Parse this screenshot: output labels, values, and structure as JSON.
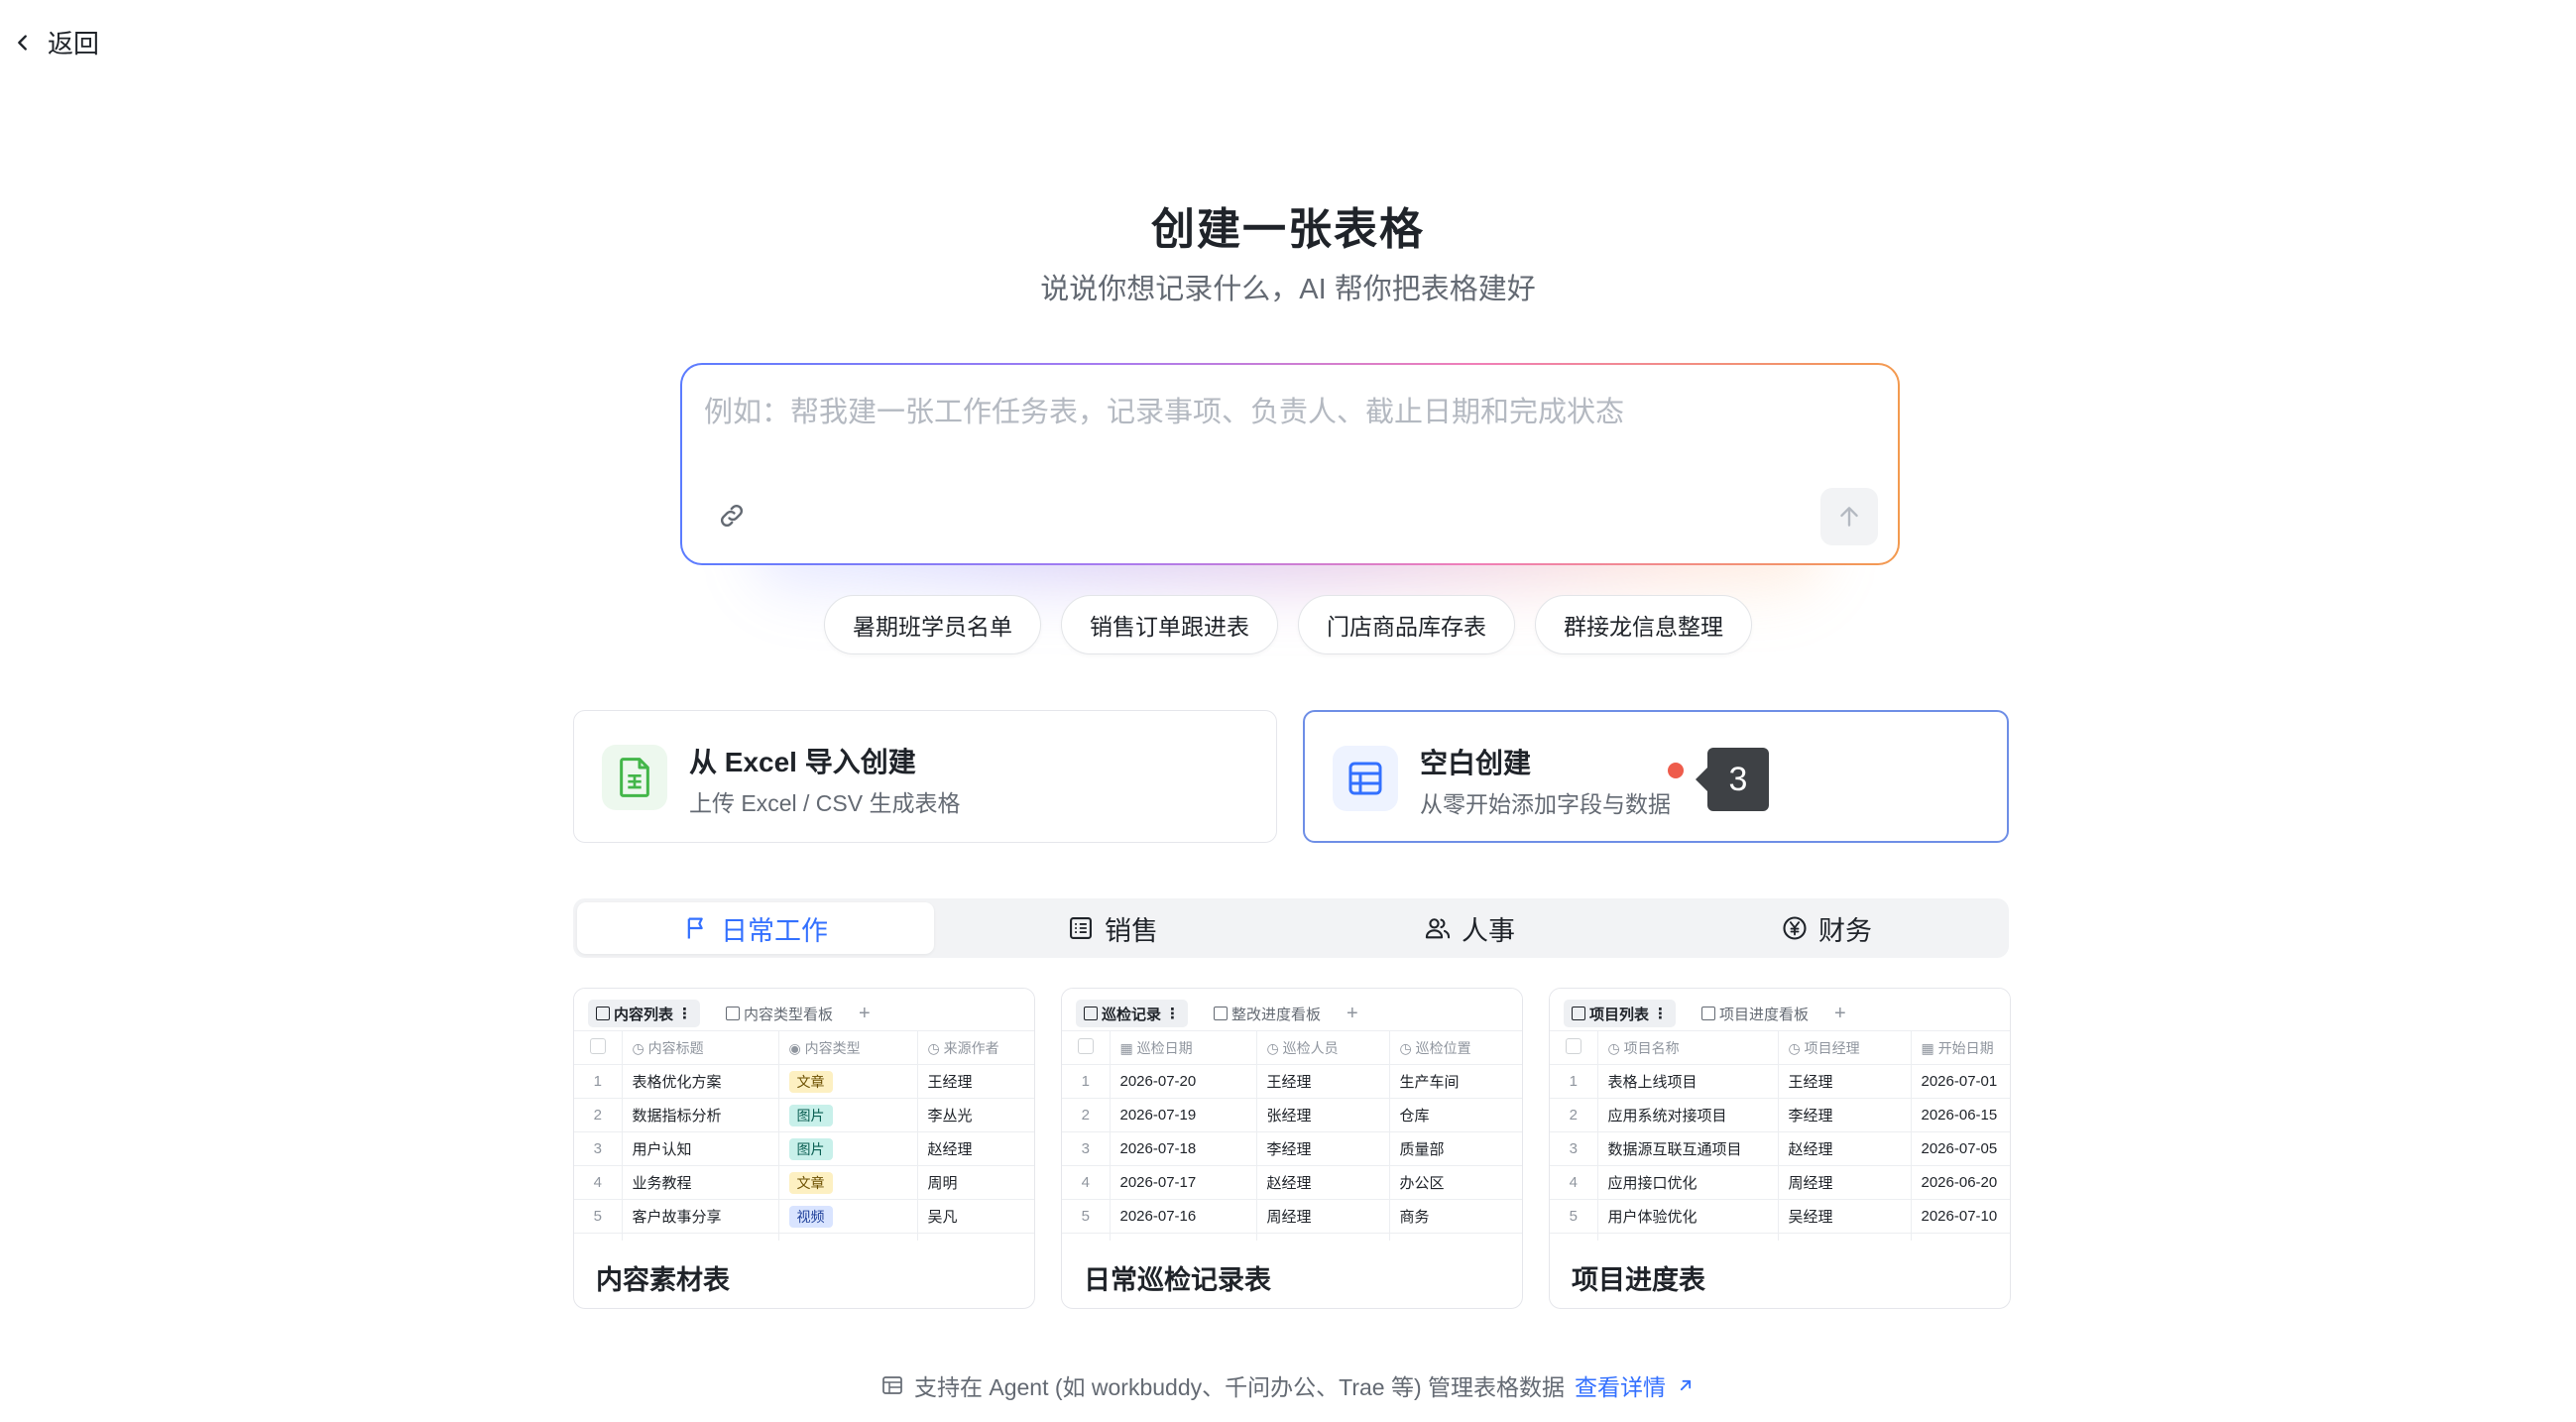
{
  "back_label": "返回",
  "title": "创建一张表格",
  "subtitle": "说说你想记录什么，AI 帮你把表格建好",
  "prompt": {
    "placeholder": "例如：帮我建一张工作任务表，记录事项、负责人、截止日期和完成状态"
  },
  "suggestions": [
    "暑期班学员名单",
    "销售订单跟进表",
    "门店商品库存表",
    "群接龙信息整理"
  ],
  "options": {
    "excel": {
      "title": "从 Excel 导入创建",
      "subtitle": "上传 Excel / CSV 生成表格"
    },
    "blank": {
      "title": "空白创建",
      "subtitle": "从零开始添加字段与数据",
      "tooltip": "3"
    }
  },
  "categories": [
    {
      "label": "日常工作",
      "icon": "flag-icon",
      "active": true
    },
    {
      "label": "销售",
      "icon": "list-icon",
      "active": false
    },
    {
      "label": "人事",
      "icon": "people-icon",
      "active": false
    },
    {
      "label": "财务",
      "icon": "yuan-icon",
      "active": false
    }
  ],
  "templates": [
    {
      "name": "内容素材表",
      "view_tabs": [
        "内容列表",
        "内容类型看板"
      ],
      "columns": [
        "内容标题",
        "内容类型",
        "来源作者"
      ],
      "rows": [
        [
          "1",
          "表格优化方案",
          "文章",
          "王经理"
        ],
        [
          "2",
          "数据指标分析",
          "图片",
          "李丛光"
        ],
        [
          "3",
          "用户认知",
          "图片",
          "赵经理"
        ],
        [
          "4",
          "业务教程",
          "文章",
          "周明"
        ],
        [
          "5",
          "客户故事分享",
          "视频",
          "吴凡"
        ]
      ]
    },
    {
      "name": "日常巡检记录表",
      "view_tabs": [
        "巡检记录",
        "整改进度看板"
      ],
      "columns": [
        "巡检日期",
        "巡检人员",
        "巡检位置"
      ],
      "rows": [
        [
          "1",
          "2026-07-20",
          "王经理",
          "生产车间"
        ],
        [
          "2",
          "2026-07-19",
          "张经理",
          "仓库"
        ],
        [
          "3",
          "2026-07-18",
          "李经理",
          "质量部"
        ],
        [
          "4",
          "2026-07-17",
          "赵经理",
          "办公区"
        ],
        [
          "5",
          "2026-07-16",
          "周经理",
          "商务"
        ]
      ]
    },
    {
      "name": "项目进度表",
      "view_tabs": [
        "项目列表",
        "项目进度看板"
      ],
      "columns": [
        "项目名称",
        "项目经理",
        "开始日期"
      ],
      "rows": [
        [
          "1",
          "表格上线项目",
          "王经理",
          "2026-07-01"
        ],
        [
          "2",
          "应用系统对接项目",
          "李经理",
          "2026-06-15"
        ],
        [
          "3",
          "数据源互联互通项目",
          "赵经理",
          "2026-07-05"
        ],
        [
          "4",
          "应用接口优化",
          "周经理",
          "2026-06-20"
        ],
        [
          "5",
          "用户体验优化",
          "吴经理",
          "2026-07-10"
        ]
      ]
    }
  ],
  "footer": {
    "text": "支持在 Agent (如 workbuddy、千问办公、Trae 等) 管理表格数据",
    "link": "查看详情"
  },
  "colors": {
    "accent": "#3370ff",
    "dot": "#ee5c4c",
    "excel_green": "#43b649"
  }
}
